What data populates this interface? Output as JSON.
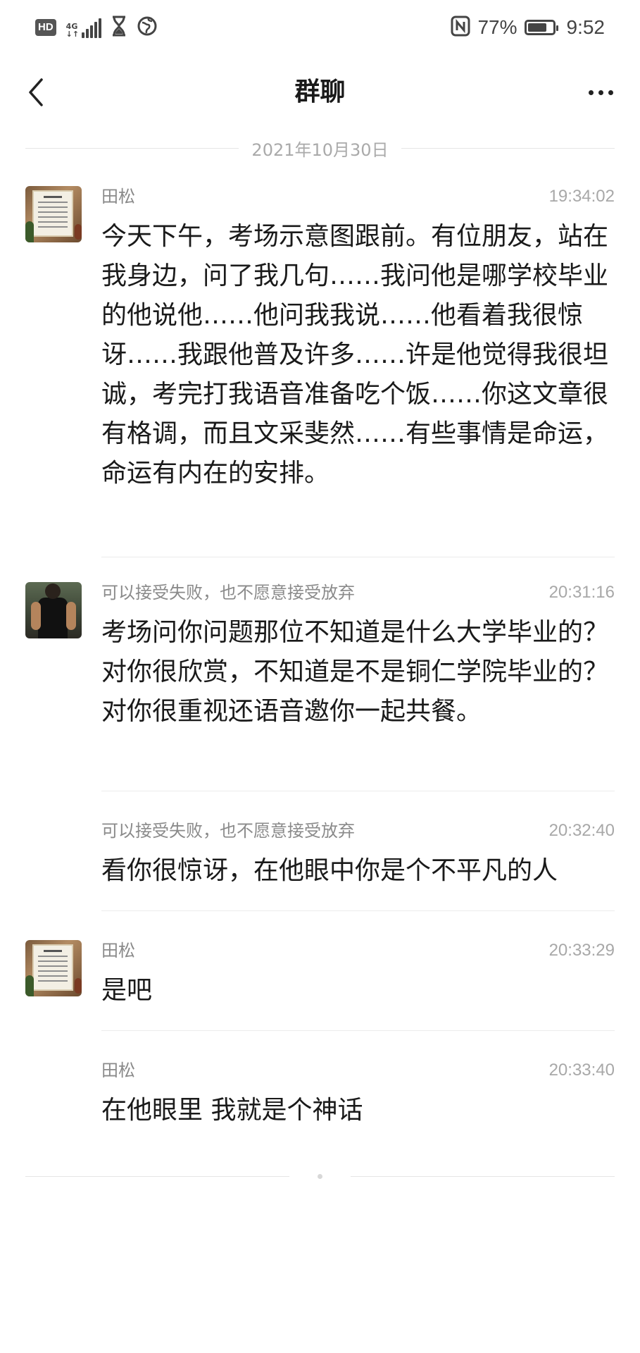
{
  "status_bar": {
    "hd_label": "HD",
    "network_label": "4G",
    "battery_percent_text": "77%",
    "battery_level": 0.77,
    "time": "9:52",
    "icons": [
      "signal-icon",
      "hourglass-icon",
      "vpn-globe-icon",
      "nfc-icon",
      "battery-icon"
    ]
  },
  "nav": {
    "title": "群聊",
    "back_icon": "chevron-left-icon",
    "more_icon": "more-horizontal-icon"
  },
  "date_divider": "2021年10月30日",
  "messages": [
    {
      "sender": "田松",
      "time": "19:34:02",
      "text": "今天下午，考场示意图跟前。有位朋友，站在我身边，问了我几句……我问他是哪学校毕业的他说他……他问我我说……他看着我很惊讶……我跟他普及许多……许是他觉得我很坦诚，考完打我语音准备吃个饭……你这文章很有格调，而且文采斐然……有些事情是命运，命运有内在的安排。",
      "avatar": "framed-certificate-avatar"
    },
    {
      "sender": "可以接受失败，也不愿意接受放弃",
      "time": "20:31:16",
      "text": "考场问你问题那位不知道是什么大学毕业的？对你很欣赏，不知道是不是铜仁学院毕业的？对你很重视还语音邀你一起共餐。",
      "avatar": "muscular-man-avatar"
    },
    {
      "sender": "可以接受失败，也不愿意接受放弃",
      "time": "20:32:40",
      "text": "看你很惊讶，在他眼中你是个不平凡的人"
    },
    {
      "sender": "田松",
      "time": "20:33:29",
      "text": "是吧",
      "avatar": "framed-certificate-avatar"
    },
    {
      "sender": "田松",
      "time": "20:33:40",
      "text": "在他眼里 我就是个神话"
    }
  ]
}
